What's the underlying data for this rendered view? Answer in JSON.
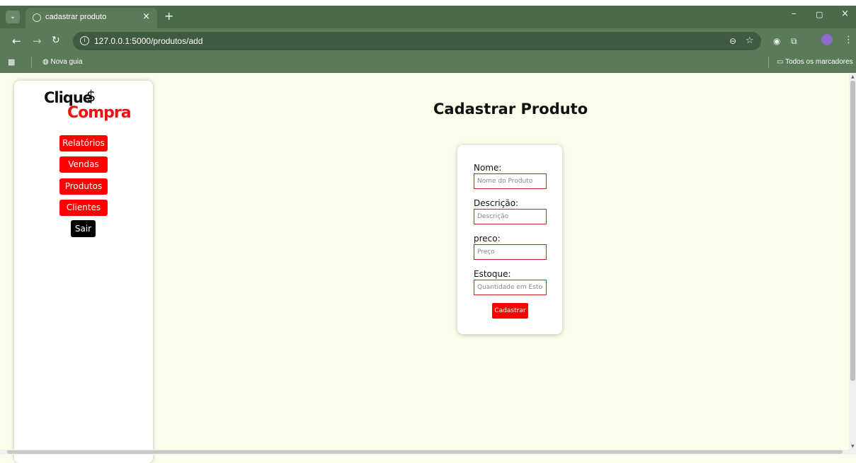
{
  "browser": {
    "tab_title": "cadastrar produto",
    "tab_close": "×",
    "new_tab": "+",
    "url": "127.0.0.1:5000/produtos/add",
    "bookmark_new_tab": "Nova guia",
    "bookmark_all": "Todos os marcadores",
    "window_min": "–",
    "window_restore": "▢",
    "window_close": "×"
  },
  "sidebar": {
    "logo_top": "Clique",
    "logo_dollar": "$",
    "logo_bottom": "Compra",
    "items": [
      {
        "label": "Relatórios"
      },
      {
        "label": "Vendas"
      },
      {
        "label": "Produtos"
      },
      {
        "label": "Clientes"
      },
      {
        "label": "Sair"
      }
    ]
  },
  "page": {
    "title": "Cadastrar Produto"
  },
  "form": {
    "fields": [
      {
        "label": "Nome:",
        "placeholder": "Nome do Produto"
      },
      {
        "label": "Descrição:",
        "placeholder": "Descrição"
      },
      {
        "label": "preco:",
        "placeholder": "Preço"
      },
      {
        "label": "Estoque:",
        "placeholder": "Quantidade em Estoque"
      }
    ],
    "submit_label": "Cadastrar"
  },
  "colors": {
    "accent": "#ff0000",
    "chrome": "#5a7a5a",
    "page_background": "#fdfdec"
  }
}
